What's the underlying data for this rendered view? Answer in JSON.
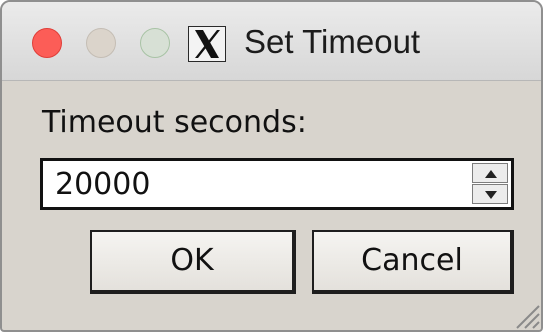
{
  "window": {
    "title": "Set Timeout",
    "controls": [
      "close",
      "minimize",
      "zoom"
    ],
    "app_icon": "x11-icon"
  },
  "form": {
    "timeout_label": "Timeout seconds:",
    "timeout_value": "20000"
  },
  "buttons": {
    "ok_label": "OK",
    "cancel_label": "Cancel"
  },
  "colors": {
    "close_light": "#fc5d57",
    "window_bg": "#d8d4cd"
  }
}
